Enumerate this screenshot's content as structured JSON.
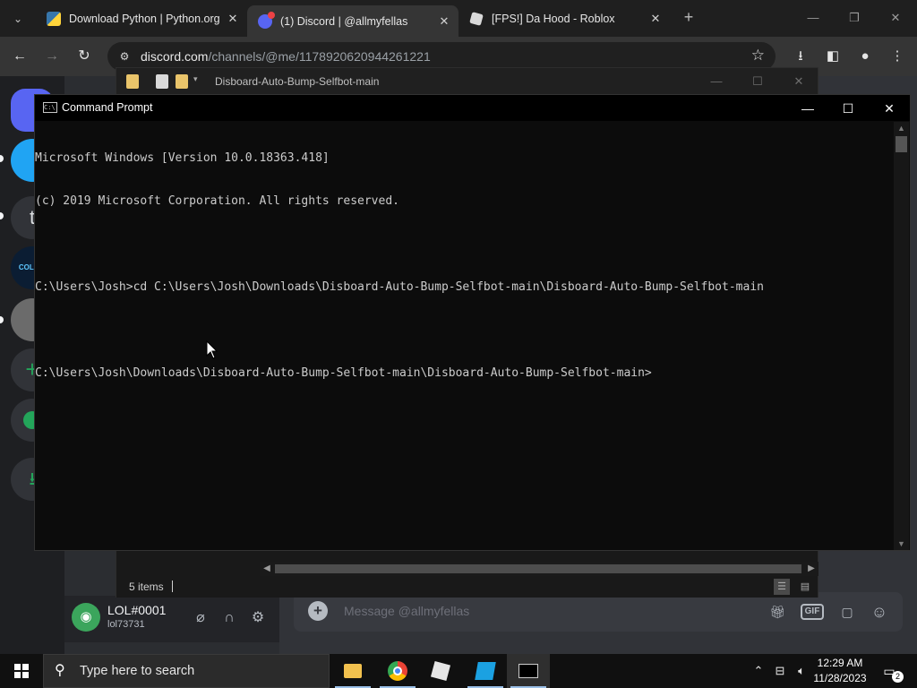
{
  "browser": {
    "tabs": [
      {
        "title": "Download Python | Python.org",
        "active": false
      },
      {
        "title": "(1) Discord | @allmyfellas",
        "active": true
      },
      {
        "title": "[FPS!] Da Hood - Roblox",
        "active": false
      }
    ],
    "new_tab_label": "+",
    "address": {
      "host": "discord.com",
      "path": "/channels/@me/1178920620944261221"
    }
  },
  "discord": {
    "user": {
      "name": "LOL#0001",
      "tag": "lol73731"
    },
    "message_placeholder": "Message @allmyfellas",
    "gif_label": "GIF",
    "server_letter": "t",
    "server_banner": "COLDW"
  },
  "explorer": {
    "title": "Disboard-Auto-Bump-Selfbot-main",
    "item_count": "5 items"
  },
  "cmd": {
    "title": "Command Prompt",
    "lines": [
      "Microsoft Windows [Version 10.0.18363.418]",
      "(c) 2019 Microsoft Corporation. All rights reserved.",
      "",
      "C:\\Users\\Josh>cd C:\\Users\\Josh\\Downloads\\Disboard-Auto-Bump-Selfbot-main\\Disboard-Auto-Bump-Selfbot-main",
      "",
      "C:\\Users\\Josh\\Downloads\\Disboard-Auto-Bump-Selfbot-main\\Disboard-Auto-Bump-Selfbot-main>"
    ]
  },
  "taskbar": {
    "search_placeholder": "Type here to search",
    "time": "12:29 AM",
    "date": "11/28/2023",
    "notification_count": "2"
  },
  "colors": {
    "discord_blurple": "#5865f2",
    "discord_green": "#3ba55c",
    "console_text": "#cccccc",
    "console_bg": "#0c0c0c"
  }
}
